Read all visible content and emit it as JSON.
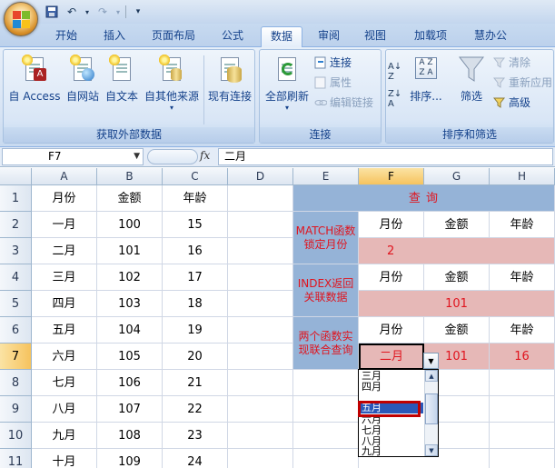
{
  "ribbon_tabs": [
    "开始",
    "插入",
    "页面布局",
    "公式",
    "数据",
    "审阅",
    "视图",
    "加载项",
    "慧办公"
  ],
  "active_tab": "数据",
  "groups": {
    "external": {
      "title": "获取外部数据",
      "access": "自 Access",
      "web": "自网站",
      "text": "自文本",
      "other": "自其他来源",
      "existing": "现有连接"
    },
    "connections": {
      "title": "连接",
      "refresh_all": "全部刷新",
      "connect": "连接",
      "props": "属性",
      "edit_links": "编辑链接"
    },
    "sort_filter": {
      "title": "排序和筛选",
      "sort": "排序...",
      "filter": "筛选",
      "clear": "清除",
      "reapply": "重新应用",
      "advanced": "高级"
    }
  },
  "formula_bar": {
    "name_box": "F7",
    "fx": "fx",
    "value": "二月"
  },
  "columns": [
    "A",
    "B",
    "C",
    "D",
    "E",
    "F",
    "G",
    "H"
  ],
  "rows": [
    "1",
    "2",
    "3",
    "4",
    "5",
    "6",
    "7",
    "8",
    "9",
    "10",
    "11"
  ],
  "left_table": {
    "headers": [
      "月份",
      "金额",
      "年龄"
    ],
    "data": [
      [
        "一月",
        "100",
        "15"
      ],
      [
        "二月",
        "101",
        "16"
      ],
      [
        "三月",
        "102",
        "17"
      ],
      [
        "四月",
        "103",
        "18"
      ],
      [
        "五月",
        "104",
        "19"
      ],
      [
        "六月",
        "105",
        "20"
      ],
      [
        "七月",
        "106",
        "21"
      ],
      [
        "八月",
        "107",
        "22"
      ],
      [
        "九月",
        "108",
        "23"
      ],
      [
        "十月",
        "109",
        "24"
      ]
    ]
  },
  "query": {
    "title": "查 询",
    "match_label": "MATCH函数锁定月份",
    "index_label": "INDEX返回关联数据",
    "combo_label": "两个函数实现联合查询",
    "hdr": [
      "月份",
      "金额",
      "年龄"
    ],
    "match_result": "2",
    "index_result": "101",
    "combo": [
      "二月",
      "101",
      "16"
    ]
  },
  "dropdown": {
    "items": [
      "三月",
      "四月",
      "五月",
      "六月",
      "七月",
      "八月",
      "九月"
    ],
    "highlighted": "五月"
  },
  "colors": {
    "blue_fill": "#95b3d7",
    "pink_fill": "#e6b8b7",
    "red_text": "#e0141e",
    "highlight_box": "#c00000"
  }
}
